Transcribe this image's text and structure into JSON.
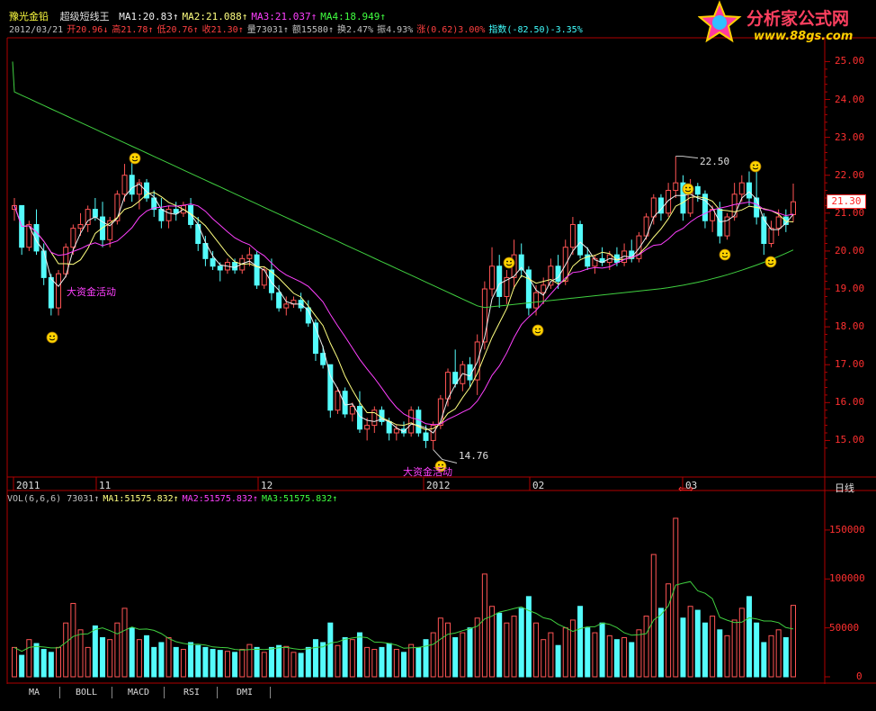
{
  "stock_name": "豫光金铅",
  "indicator_name": "超级短线王",
  "ma_line": [
    {
      "label": "MA1:20.83↑",
      "color": "#f0f0f0"
    },
    {
      "label": "MA2:21.088↑",
      "color": "#ffff80"
    },
    {
      "label": "MA3:21.037↑",
      "color": "#ff40ff"
    },
    {
      "label": "MA4:18.949↑",
      "color": "#40ff40"
    }
  ],
  "info_line": [
    {
      "label": "2012/03/21",
      "color": "#c0c0c0"
    },
    {
      "label": "开20.96↓",
      "color": "#ff4040"
    },
    {
      "label": "高21.78↑",
      "color": "#ff4040"
    },
    {
      "label": "低20.76↑",
      "color": "#ff4040"
    },
    {
      "label": "收21.30↑",
      "color": "#ff4040"
    },
    {
      "label": "量73031↑",
      "color": "#c0c0c0"
    },
    {
      "label": "额15580↑",
      "color": "#c0c0c0"
    },
    {
      "label": "换2.47%",
      "color": "#c0c0c0"
    },
    {
      "label": "振4.93%",
      "color": "#c0c0c0"
    },
    {
      "label": "涨(0.62)3.00%",
      "color": "#ff4040"
    },
    {
      "label": "指数(-82.50)-3.35%",
      "color": "#40ffff"
    }
  ],
  "logo": {
    "main": "分析家公式网",
    "url": "www.88gs.com"
  },
  "price_axis": [
    "25.00",
    "24.00",
    "23.00",
    "22.00",
    "21.00",
    "20.00",
    "19.00",
    "18.00",
    "17.00",
    "16.00",
    "15.00"
  ],
  "current_price": "21.30",
  "date_axis": [
    "2011",
    "11",
    "12",
    "2012",
    "02",
    "03"
  ],
  "period_label": "日线",
  "annotations": {
    "high": "22.50",
    "low": "14.76",
    "money_activity": "大资金活动"
  },
  "vol_line": [
    {
      "label": "VOL(6,6,6) 73031↑",
      "color": "#c0c0c0"
    },
    {
      "label": "MA1:51575.832↑",
      "color": "#ffff80"
    },
    {
      "label": "MA2:51575.832↑",
      "color": "#ff40ff"
    },
    {
      "label": "MA3:51575.832↑",
      "color": "#40ff40"
    }
  ],
  "vol_axis": [
    "150000",
    "100000",
    "50000",
    "0"
  ],
  "tabs": [
    "MA",
    "BOLL",
    "MACD",
    "RSI",
    "DMI"
  ],
  "chart_data": {
    "type": "candlestick",
    "price_range": [
      14.5,
      25.3
    ],
    "volume_range": [
      0,
      165000
    ],
    "candles": [
      [
        21.1,
        21.4,
        20.8,
        21.2
      ],
      [
        21.2,
        21.0,
        19.9,
        20.1
      ],
      [
        20.1,
        20.8,
        20.0,
        20.7
      ],
      [
        20.7,
        21.1,
        19.9,
        20.0
      ],
      [
        20.0,
        20.2,
        19.1,
        19.3
      ],
      [
        19.3,
        19.4,
        18.3,
        18.5
      ],
      [
        18.5,
        19.5,
        18.3,
        19.4
      ],
      [
        19.4,
        20.2,
        19.3,
        20.1
      ],
      [
        20.1,
        20.7,
        19.9,
        20.6
      ],
      [
        20.6,
        21.0,
        20.4,
        20.7
      ],
      [
        20.7,
        21.2,
        20.5,
        21.1
      ],
      [
        21.1,
        21.4,
        20.8,
        20.9
      ],
      [
        20.9,
        21.3,
        20.1,
        20.3
      ],
      [
        20.3,
        20.9,
        20.1,
        20.8
      ],
      [
        20.8,
        21.6,
        20.7,
        21.5
      ],
      [
        21.5,
        22.3,
        21.3,
        22.0
      ],
      [
        22.0,
        22.4,
        21.3,
        21.5
      ],
      [
        21.5,
        21.9,
        21.1,
        21.8
      ],
      [
        21.8,
        21.9,
        21.3,
        21.4
      ],
      [
        21.4,
        21.6,
        20.9,
        21.1
      ],
      [
        21.1,
        21.4,
        20.6,
        20.8
      ],
      [
        20.8,
        21.2,
        20.6,
        21.1
      ],
      [
        21.1,
        21.3,
        20.8,
        21.0
      ],
      [
        21.0,
        21.3,
        20.9,
        21.2
      ],
      [
        21.2,
        21.4,
        20.6,
        20.7
      ],
      [
        20.7,
        20.9,
        20.0,
        20.2
      ],
      [
        20.2,
        20.4,
        19.6,
        19.8
      ],
      [
        19.8,
        20.0,
        19.5,
        19.6
      ],
      [
        19.6,
        19.7,
        19.2,
        19.5
      ],
      [
        19.5,
        19.8,
        19.4,
        19.7
      ],
      [
        19.7,
        19.8,
        19.4,
        19.5
      ],
      [
        19.5,
        19.9,
        19.4,
        19.8
      ],
      [
        19.8,
        20.1,
        19.6,
        19.9
      ],
      [
        19.9,
        20.0,
        19.0,
        19.1
      ],
      [
        19.1,
        19.6,
        19.0,
        19.5
      ],
      [
        19.5,
        19.8,
        18.7,
        18.9
      ],
      [
        18.9,
        19.1,
        18.4,
        18.5
      ],
      [
        18.5,
        18.8,
        18.3,
        18.6
      ],
      [
        18.6,
        18.8,
        18.5,
        18.7
      ],
      [
        18.7,
        18.9,
        18.4,
        18.5
      ],
      [
        18.5,
        18.7,
        18.0,
        18.1
      ],
      [
        18.1,
        18.2,
        17.1,
        17.3
      ],
      [
        17.3,
        17.5,
        16.9,
        17.0
      ],
      [
        17.0,
        16.9,
        15.6,
        15.8
      ],
      [
        15.8,
        16.4,
        15.7,
        16.3
      ],
      [
        16.3,
        16.4,
        15.6,
        15.7
      ],
      [
        15.7,
        16.0,
        15.5,
        15.9
      ],
      [
        15.9,
        16.3,
        15.2,
        15.3
      ],
      [
        15.3,
        15.6,
        15.0,
        15.4
      ],
      [
        15.4,
        15.9,
        15.2,
        15.8
      ],
      [
        15.8,
        15.9,
        15.4,
        15.5
      ],
      [
        15.5,
        15.6,
        15.0,
        15.2
      ],
      [
        15.2,
        15.4,
        15.0,
        15.3
      ],
      [
        15.3,
        15.5,
        15.1,
        15.2
      ],
      [
        15.2,
        15.9,
        15.1,
        15.8
      ],
      [
        15.8,
        15.9,
        15.1,
        15.2
      ],
      [
        15.2,
        15.4,
        14.8,
        15.0
      ],
      [
        15.0,
        15.5,
        14.76,
        15.4
      ],
      [
        15.4,
        16.2,
        15.3,
        16.1
      ],
      [
        16.1,
        16.9,
        15.9,
        16.8
      ],
      [
        16.8,
        17.4,
        16.4,
        16.5
      ],
      [
        16.5,
        17.1,
        16.3,
        17.0
      ],
      [
        17.0,
        17.2,
        16.4,
        16.6
      ],
      [
        16.6,
        17.8,
        16.2,
        17.6
      ],
      [
        17.6,
        19.2,
        17.4,
        19.0
      ],
      [
        19.0,
        20.1,
        18.8,
        19.6
      ],
      [
        19.6,
        19.9,
        18.5,
        18.8
      ],
      [
        18.8,
        19.5,
        18.6,
        19.3
      ],
      [
        19.3,
        20.3,
        19.0,
        19.9
      ],
      [
        19.9,
        20.2,
        19.3,
        19.5
      ],
      [
        19.5,
        19.6,
        18.3,
        18.5
      ],
      [
        18.5,
        19.1,
        18.3,
        18.9
      ],
      [
        18.9,
        19.3,
        18.6,
        19.1
      ],
      [
        19.1,
        19.8,
        19.0,
        19.6
      ],
      [
        19.6,
        19.9,
        19.0,
        19.2
      ],
      [
        19.2,
        20.3,
        19.1,
        20.1
      ],
      [
        20.1,
        20.9,
        19.9,
        20.7
      ],
      [
        20.7,
        20.8,
        19.8,
        19.9
      ],
      [
        19.9,
        20.1,
        19.5,
        19.6
      ],
      [
        19.6,
        19.9,
        19.4,
        19.8
      ],
      [
        19.8,
        20.1,
        19.6,
        19.7
      ],
      [
        19.7,
        20.0,
        19.5,
        19.9
      ],
      [
        19.9,
        20.1,
        19.6,
        19.7
      ],
      [
        19.7,
        20.2,
        19.6,
        20.0
      ],
      [
        20.0,
        20.3,
        19.7,
        19.8
      ],
      [
        19.8,
        20.5,
        19.7,
        20.4
      ],
      [
        20.4,
        21.0,
        20.3,
        20.9
      ],
      [
        20.9,
        21.5,
        20.7,
        21.4
      ],
      [
        21.4,
        21.5,
        20.8,
        21.0
      ],
      [
        21.0,
        21.8,
        20.9,
        21.6
      ],
      [
        21.6,
        22.5,
        21.4,
        21.8
      ],
      [
        21.8,
        22.0,
        20.8,
        21.0
      ],
      [
        21.0,
        21.9,
        20.9,
        21.7
      ],
      [
        21.7,
        21.8,
        21.3,
        21.5
      ],
      [
        21.5,
        21.6,
        20.6,
        20.8
      ],
      [
        20.8,
        21.2,
        20.5,
        21.1
      ],
      [
        21.1,
        21.3,
        20.2,
        20.4
      ],
      [
        20.4,
        21.0,
        20.3,
        20.9
      ],
      [
        20.9,
        21.8,
        20.8,
        21.5
      ],
      [
        21.5,
        22.0,
        21.3,
        21.8
      ],
      [
        21.8,
        22.1,
        21.2,
        21.4
      ],
      [
        21.4,
        22.2,
        20.7,
        20.9
      ],
      [
        20.9,
        21.0,
        19.9,
        20.2
      ],
      [
        20.2,
        20.8,
        20.1,
        20.6
      ],
      [
        20.6,
        21.1,
        20.4,
        20.9
      ],
      [
        20.9,
        21.1,
        20.5,
        20.7
      ],
      [
        20.96,
        21.78,
        20.76,
        21.3
      ]
    ],
    "volumes": [
      30000,
      22000,
      38000,
      34000,
      28000,
      25000,
      30000,
      55000,
      75000,
      48000,
      30000,
      52000,
      40000,
      38000,
      55000,
      70000,
      50000,
      38000,
      42000,
      30000,
      35000,
      40000,
      30000,
      28000,
      35000,
      32000,
      30000,
      28000,
      27000,
      26000,
      25000,
      28000,
      33000,
      30000,
      25000,
      30000,
      32000,
      31000,
      25000,
      24000,
      30000,
      38000,
      35000,
      55000,
      32000,
      40000,
      38000,
      45000,
      30000,
      28000,
      30000,
      34000,
      28000,
      25000,
      33000,
      30000,
      38000,
      45000,
      60000,
      55000,
      40000,
      45000,
      50000,
      60000,
      105000,
      72000,
      65000,
      55000,
      62000,
      70000,
      82000,
      55000,
      38000,
      45000,
      32000,
      50000,
      58000,
      72000,
      50000,
      45000,
      55000,
      42000,
      38000,
      40000,
      35000,
      48000,
      62000,
      125000,
      70000,
      95000,
      162000,
      60000,
      72000,
      68000,
      55000,
      62000,
      48000,
      42000,
      58000,
      70000,
      82000,
      55000,
      35000,
      42000,
      48000,
      40000,
      73000
    ],
    "ma1": "white",
    "ma2": "yellow",
    "ma3": "magenta",
    "ma4": "green"
  }
}
